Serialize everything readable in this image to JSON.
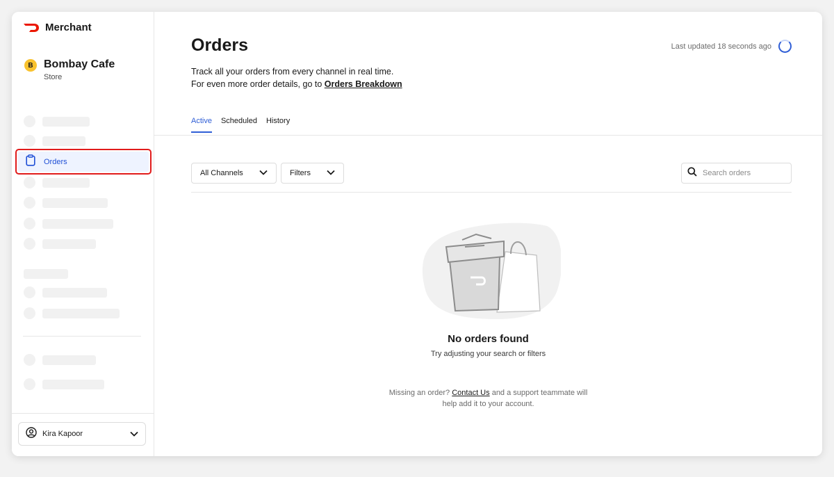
{
  "sidebar": {
    "brand_name": "Merchant",
    "store": {
      "initial": "B",
      "name": "Bombay Cafe",
      "type": "Store"
    },
    "nav_orders_label": "Orders",
    "user_name": "Kira Kapoor"
  },
  "header": {
    "title": "Orders",
    "subtitle_line1": "Track all your orders from every channel in real time.",
    "subtitle_line2_prefix": "For even more order details, go to ",
    "subtitle_link": "Orders Breakdown",
    "last_updated": "Last updated 18 seconds ago"
  },
  "tabs": [
    {
      "label": "Active",
      "active": true
    },
    {
      "label": "Scheduled",
      "active": false
    },
    {
      "label": "History",
      "active": false
    }
  ],
  "filters": {
    "channels_label": "All Channels",
    "filters_label": "Filters",
    "search_placeholder": "Search orders"
  },
  "empty_state": {
    "title": "No orders found",
    "subtitle": "Try adjusting your search or filters",
    "help_prefix": "Missing an order? ",
    "help_link": "Contact Us",
    "help_suffix": " and a support teammate will help add it to your account."
  },
  "colors": {
    "brand_red": "#eb1700",
    "accent_blue": "#2f5ed6",
    "highlight_border": "#e11b1b",
    "store_avatar": "#f9c22e"
  },
  "icons": [
    "doordash-logo-icon",
    "clipboard-icon",
    "chevron-down-icon",
    "search-icon",
    "user-circle-icon",
    "loading-spinner-icon"
  ]
}
